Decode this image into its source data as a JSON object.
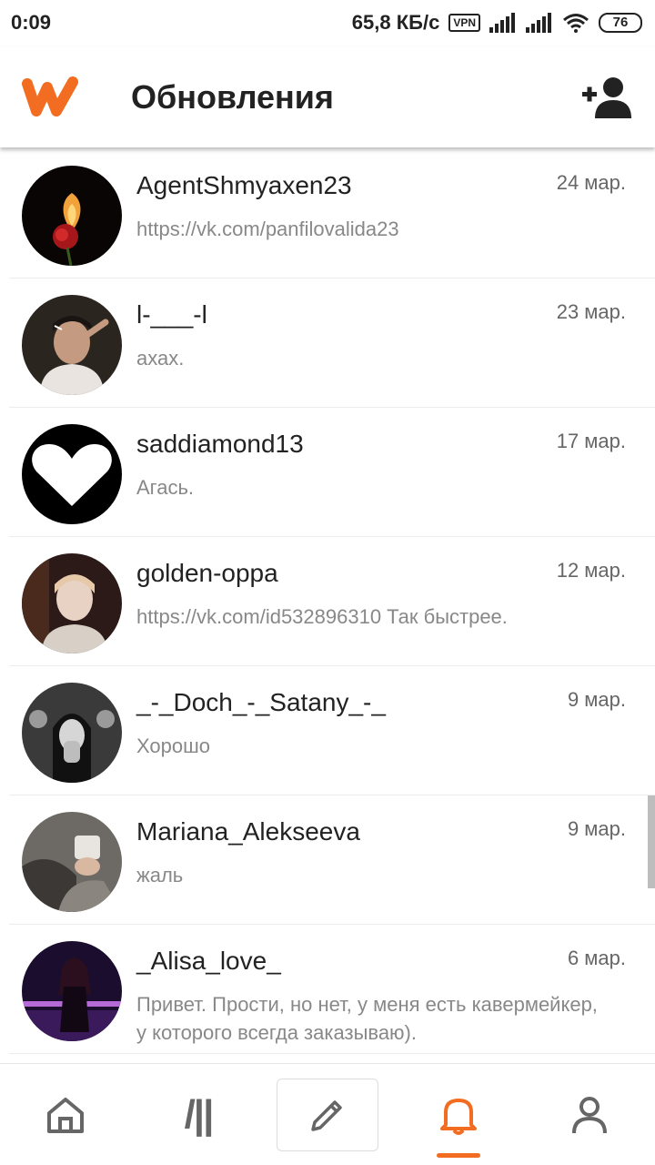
{
  "status_bar": {
    "time": "0:09",
    "net_speed": "65,8 КБ/с",
    "vpn": "VPN",
    "battery": "76"
  },
  "app_bar": {
    "title": "Обновления",
    "logo_icon": "wattpad-logo",
    "action_icon": "add-person-icon"
  },
  "accent_color": "#f26d21",
  "conversations": [
    {
      "name": "AgentShmyaxen23",
      "date": "24 мар.",
      "message": "https://vk.com/panfilovalida23"
    },
    {
      "name": "l-___-l",
      "date": "23 мар.",
      "message": "ахах."
    },
    {
      "name": "saddiamond13",
      "date": "17 мар.",
      "message": "Агась."
    },
    {
      "name": "golden-oppa",
      "date": "12 мар.",
      "message": "https://vk.com/id532896310 Так быстрее."
    },
    {
      "name": "_-_Doch_-_Satany_-_",
      "date": "9 мар.",
      "message": "Хорошо"
    },
    {
      "name": "Mariana_Alekseeva",
      "date": "9 мар.",
      "message": "жаль"
    },
    {
      "name": "_Alisa_love_",
      "date": "6 мар.",
      "message": "Привет. Прости, но нет, у меня есть кавермейкер, у которого всегда заказываю)."
    }
  ],
  "bottom_nav": {
    "library_glyph": "/||",
    "items": [
      "home-icon",
      "library-icon",
      "write-icon",
      "notifications-icon",
      "profile-icon"
    ],
    "active": "notifications-icon"
  }
}
